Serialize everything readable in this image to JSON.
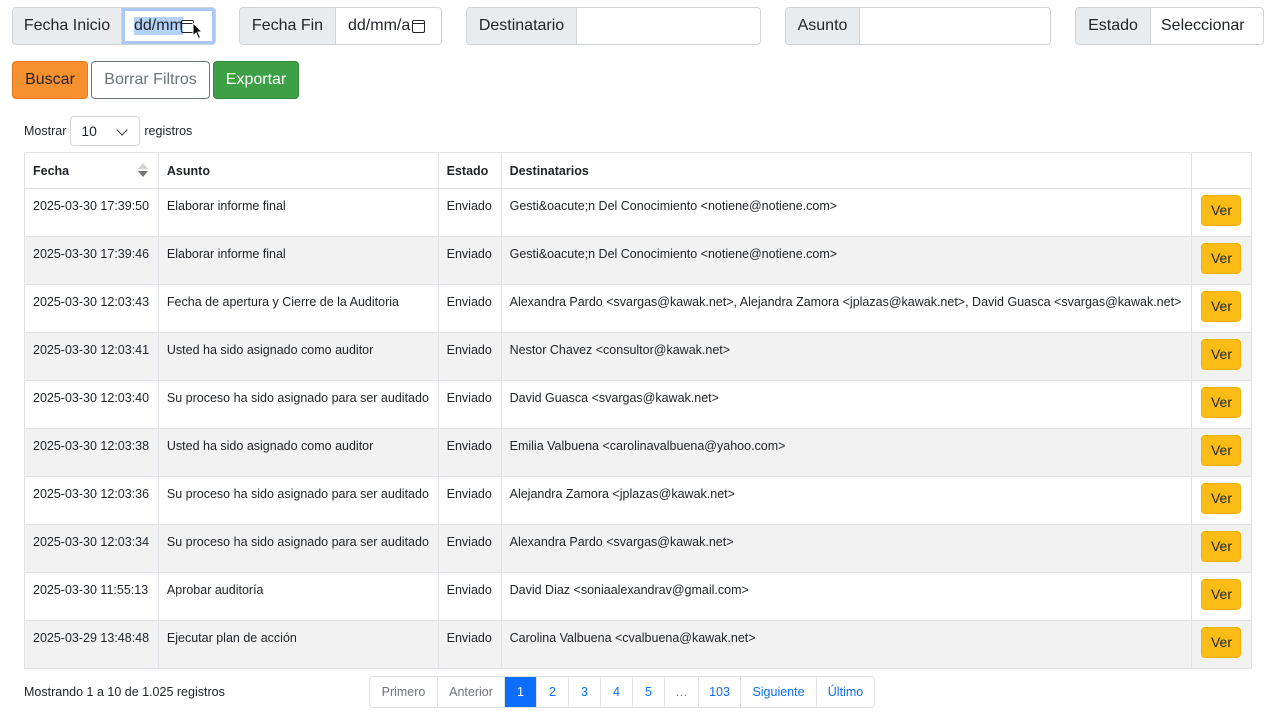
{
  "filters": {
    "fecha_inicio": {
      "label": "Fecha Inicio",
      "value": "dd/mm"
    },
    "fecha_fin": {
      "label": "Fecha Fin",
      "value": "dd/mm/a"
    },
    "destinatario": {
      "label": "Destinatario",
      "value": ""
    },
    "asunto": {
      "label": "Asunto",
      "value": ""
    },
    "estado": {
      "label": "Estado",
      "value": "Seleccionar"
    }
  },
  "actions": {
    "buscar": "Buscar",
    "borrar": "Borrar Filtros",
    "exportar": "Exportar"
  },
  "length": {
    "prefix": "Mostrar",
    "value": "10",
    "suffix": "registros"
  },
  "table": {
    "headers": [
      "Fecha",
      "Asunto",
      "Estado",
      "Destinatarios",
      ""
    ],
    "action_label": "Ver",
    "rows": [
      [
        "2025-03-30 17:39:50",
        "Elaborar informe final",
        "Enviado",
        "Gesti&oacute;n Del Conocimiento <notiene@notiene.com>"
      ],
      [
        "2025-03-30 17:39:46",
        "Elaborar informe final",
        "Enviado",
        "Gesti&oacute;n Del Conocimiento <notiene@notiene.com>"
      ],
      [
        "2025-03-30 12:03:43",
        "Fecha de apertura y Cierre de la Auditoria",
        "Enviado",
        "Alexandra Pardo <svargas@kawak.net>, Alejandra Zamora <jplazas@kawak.net>, David Guasca <svargas@kawak.net>"
      ],
      [
        "2025-03-30 12:03:41",
        "Usted ha sido asignado como auditor",
        "Enviado",
        "Nestor Chavez <consultor@kawak.net>"
      ],
      [
        "2025-03-30 12:03:40",
        "Su proceso ha sido asignado para ser auditado",
        "Enviado",
        "David Guasca <svargas@kawak.net>"
      ],
      [
        "2025-03-30 12:03:38",
        "Usted ha sido asignado como auditor",
        "Enviado",
        "Emilia Valbuena <carolinavalbuena@yahoo.com>"
      ],
      [
        "2025-03-30 12:03:36",
        "Su proceso ha sido asignado para ser auditado",
        "Enviado",
        "Alejandra Zamora <jplazas@kawak.net>"
      ],
      [
        "2025-03-30 12:03:34",
        "Su proceso ha sido asignado para ser auditado",
        "Enviado",
        "Alexandra Pardo <svargas@kawak.net>"
      ],
      [
        "2025-03-30 11:55:13",
        "Aprobar auditoría",
        "Enviado",
        "David Diaz <soniaalexandrav@gmail.com>"
      ],
      [
        "2025-03-29 13:48:48",
        "Ejecutar plan de acción",
        "Enviado",
        "Carolina Valbuena <cvalbuena@kawak.net>"
      ]
    ]
  },
  "info": "Mostrando 1 a 10 de 1.025 registros",
  "pagination": {
    "first": "Primero",
    "prev": "Anterior",
    "pages": [
      "1",
      "2",
      "3",
      "4",
      "5",
      "…",
      "103"
    ],
    "active": "1",
    "next": "Siguiente",
    "last": "Último"
  }
}
